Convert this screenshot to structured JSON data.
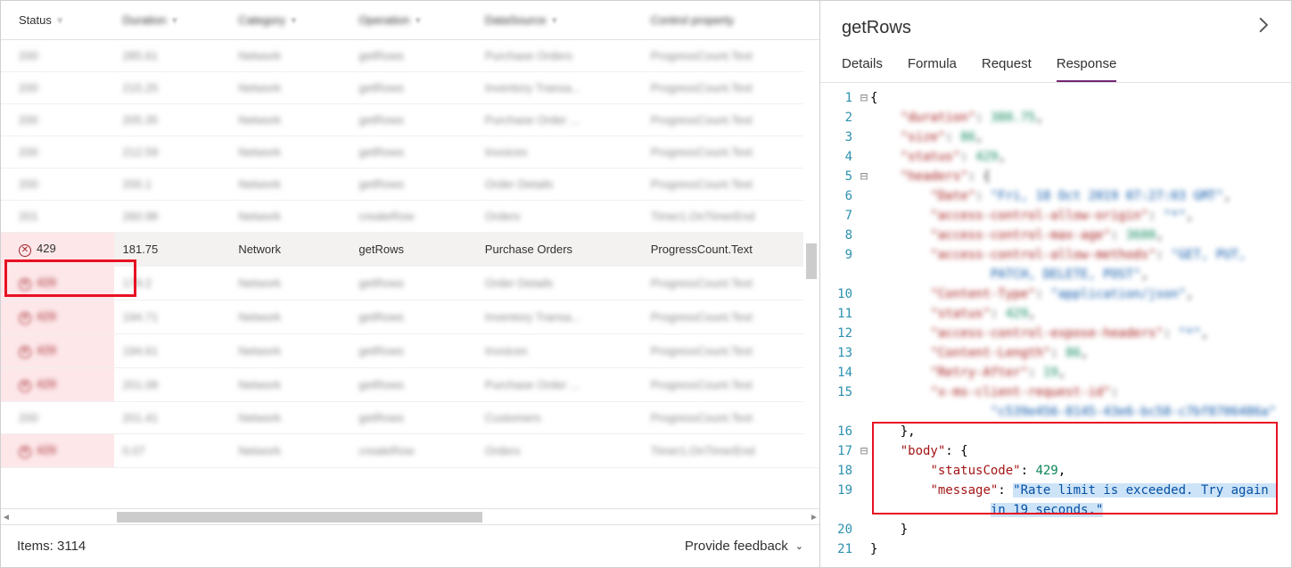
{
  "table": {
    "columns": [
      "Status",
      "Duration",
      "Category",
      "Operation",
      "DataSource",
      "Control property"
    ],
    "rows": [
      {
        "status": "200",
        "duration": "285.61",
        "category": "Network",
        "operation": "getRows",
        "datasource": "Purchase Orders",
        "control": "ProgressCount.Text",
        "err": false,
        "blur": true
      },
      {
        "status": "200",
        "duration": "215.25",
        "category": "Network",
        "operation": "getRows",
        "datasource": "Inventory Transa...",
        "control": "ProgressCount.Text",
        "err": false,
        "blur": true
      },
      {
        "status": "200",
        "duration": "205.35",
        "category": "Network",
        "operation": "getRows",
        "datasource": "Purchase Order ...",
        "control": "ProgressCount.Text",
        "err": false,
        "blur": true
      },
      {
        "status": "200",
        "duration": "212.59",
        "category": "Network",
        "operation": "getRows",
        "datasource": "Invoices",
        "control": "ProgressCount.Text",
        "err": false,
        "blur": true
      },
      {
        "status": "200",
        "duration": "200.1",
        "category": "Network",
        "operation": "getRows",
        "datasource": "Order Details",
        "control": "ProgressCount.Text",
        "err": false,
        "blur": true
      },
      {
        "status": "201",
        "duration": "260.98",
        "category": "Network",
        "operation": "createRow",
        "datasource": "Orders",
        "control": "Timer1.OnTimerEnd",
        "err": false,
        "blur": true
      },
      {
        "status": "429",
        "duration": "181.75",
        "category": "Network",
        "operation": "getRows",
        "datasource": "Purchase Orders",
        "control": "ProgressCount.Text",
        "err": true,
        "blur": false,
        "selected": true
      },
      {
        "status": "429",
        "duration": "178.2",
        "category": "Network",
        "operation": "getRows",
        "datasource": "Order Details",
        "control": "ProgressCount.Text",
        "err": true,
        "blur": true
      },
      {
        "status": "429",
        "duration": "194.71",
        "category": "Network",
        "operation": "getRows",
        "datasource": "Inventory Transa...",
        "control": "ProgressCount.Text",
        "err": true,
        "blur": true
      },
      {
        "status": "429",
        "duration": "194.61",
        "category": "Network",
        "operation": "getRows",
        "datasource": "Invoices",
        "control": "ProgressCount.Text",
        "err": true,
        "blur": true
      },
      {
        "status": "429",
        "duration": "201.08",
        "category": "Network",
        "operation": "getRows",
        "datasource": "Purchase Order ...",
        "control": "ProgressCount.Text",
        "err": true,
        "blur": true
      },
      {
        "status": "200",
        "duration": "201.41",
        "category": "Network",
        "operation": "getRows",
        "datasource": "Customers",
        "control": "ProgressCount.Text",
        "err": false,
        "blur": true
      },
      {
        "status": "429",
        "duration": "0.07",
        "category": "Network",
        "operation": "createRow",
        "datasource": "Orders",
        "control": "Timer1.OnTimerEnd",
        "err": true,
        "blur": true
      }
    ]
  },
  "footer": {
    "items_label": "Items: 3114",
    "feedback": "Provide feedback"
  },
  "right": {
    "title": "getRows",
    "tabs": [
      "Details",
      "Formula",
      "Request",
      "Response"
    ],
    "active_tab": 3,
    "code": [
      {
        "n": 1,
        "fold": "⊟",
        "ind": 0,
        "blur": false,
        "segs": [
          {
            "t": "{",
            "c": "k-punc"
          }
        ]
      },
      {
        "n": 2,
        "fold": "",
        "ind": 2,
        "blur": true,
        "segs": [
          {
            "t": "\"duration\"",
            "c": "k-str"
          },
          {
            "t": ": ",
            "c": "k-punc"
          },
          {
            "t": "380.75",
            "c": "k-val-num"
          },
          {
            "t": ",",
            "c": "k-punc"
          }
        ]
      },
      {
        "n": 3,
        "fold": "",
        "ind": 2,
        "blur": true,
        "segs": [
          {
            "t": "\"size\"",
            "c": "k-str"
          },
          {
            "t": ": ",
            "c": "k-punc"
          },
          {
            "t": "86",
            "c": "k-val-num"
          },
          {
            "t": ",",
            "c": "k-punc"
          }
        ]
      },
      {
        "n": 4,
        "fold": "",
        "ind": 2,
        "blur": true,
        "segs": [
          {
            "t": "\"status\"",
            "c": "k-str"
          },
          {
            "t": ": ",
            "c": "k-punc"
          },
          {
            "t": "429",
            "c": "k-val-num"
          },
          {
            "t": ",",
            "c": "k-punc"
          }
        ]
      },
      {
        "n": 5,
        "fold": "⊟",
        "ind": 2,
        "blur": true,
        "segs": [
          {
            "t": "\"headers\"",
            "c": "k-str"
          },
          {
            "t": ": {",
            "c": "k-punc"
          }
        ]
      },
      {
        "n": 6,
        "fold": "",
        "ind": 4,
        "blur": true,
        "segs": [
          {
            "t": "\"Date\"",
            "c": "k-str"
          },
          {
            "t": ": ",
            "c": "k-punc"
          },
          {
            "t": "\"Fri, 18 Oct 2019 07:27:03 GMT\"",
            "c": "k-val-str"
          },
          {
            "t": ",",
            "c": "k-punc"
          }
        ]
      },
      {
        "n": 7,
        "fold": "",
        "ind": 4,
        "blur": true,
        "segs": [
          {
            "t": "\"access-control-allow-origin\"",
            "c": "k-str"
          },
          {
            "t": ": ",
            "c": "k-punc"
          },
          {
            "t": "\"*\"",
            "c": "k-val-str"
          },
          {
            "t": ",",
            "c": "k-punc"
          }
        ]
      },
      {
        "n": 8,
        "fold": "",
        "ind": 4,
        "blur": true,
        "segs": [
          {
            "t": "\"access-control-max-age\"",
            "c": "k-str"
          },
          {
            "t": ": ",
            "c": "k-punc"
          },
          {
            "t": "3600",
            "c": "k-val-num"
          },
          {
            "t": ",",
            "c": "k-punc"
          }
        ]
      },
      {
        "n": 9,
        "fold": "",
        "ind": 4,
        "blur": true,
        "segs": [
          {
            "t": "\"access-control-allow-methods\"",
            "c": "k-str"
          },
          {
            "t": ": ",
            "c": "k-punc"
          },
          {
            "t": "\"GET, PUT,",
            "c": "k-val-str"
          }
        ]
      },
      {
        "n": "",
        "fold": "",
        "ind": 8,
        "blur": true,
        "segs": [
          {
            "t": "PATCH, DELETE, POST\"",
            "c": "k-val-str"
          },
          {
            "t": ",",
            "c": "k-punc"
          }
        ]
      },
      {
        "n": 10,
        "fold": "",
        "ind": 4,
        "blur": true,
        "segs": [
          {
            "t": "\"Content-Type\"",
            "c": "k-str"
          },
          {
            "t": ": ",
            "c": "k-punc"
          },
          {
            "t": "\"application/json\"",
            "c": "k-val-str"
          },
          {
            "t": ",",
            "c": "k-punc"
          }
        ]
      },
      {
        "n": 11,
        "fold": "",
        "ind": 4,
        "blur": true,
        "segs": [
          {
            "t": "\"status\"",
            "c": "k-str"
          },
          {
            "t": ": ",
            "c": "k-punc"
          },
          {
            "t": "429",
            "c": "k-val-num"
          },
          {
            "t": ",",
            "c": "k-punc"
          }
        ]
      },
      {
        "n": 12,
        "fold": "",
        "ind": 4,
        "blur": true,
        "segs": [
          {
            "t": "\"access-control-expose-headers\"",
            "c": "k-str"
          },
          {
            "t": ": ",
            "c": "k-punc"
          },
          {
            "t": "\"*\"",
            "c": "k-val-str"
          },
          {
            "t": ",",
            "c": "k-punc"
          }
        ]
      },
      {
        "n": 13,
        "fold": "",
        "ind": 4,
        "blur": true,
        "segs": [
          {
            "t": "\"Content-Length\"",
            "c": "k-str"
          },
          {
            "t": ": ",
            "c": "k-punc"
          },
          {
            "t": "86",
            "c": "k-val-num"
          },
          {
            "t": ",",
            "c": "k-punc"
          }
        ]
      },
      {
        "n": 14,
        "fold": "",
        "ind": 4,
        "blur": true,
        "segs": [
          {
            "t": "\"Retry-After\"",
            "c": "k-str"
          },
          {
            "t": ": ",
            "c": "k-punc"
          },
          {
            "t": "19",
            "c": "k-val-num"
          },
          {
            "t": ",",
            "c": "k-punc"
          }
        ]
      },
      {
        "n": 15,
        "fold": "",
        "ind": 4,
        "blur": true,
        "segs": [
          {
            "t": "\"x-ms-client-request-id\"",
            "c": "k-str"
          },
          {
            "t": ":",
            "c": "k-punc"
          }
        ]
      },
      {
        "n": "",
        "fold": "",
        "ind": 8,
        "blur": true,
        "segs": [
          {
            "t": "\"c539e456-8145-43e6-bc58-c7bf8706486a\"",
            "c": "k-val-str"
          }
        ]
      },
      {
        "n": 16,
        "fold": "",
        "ind": 2,
        "blur": false,
        "segs": [
          {
            "t": "},",
            "c": "k-punc"
          }
        ]
      },
      {
        "n": 17,
        "fold": "⊟",
        "ind": 2,
        "blur": false,
        "segs": [
          {
            "t": "\"body\"",
            "c": "k-str"
          },
          {
            "t": ": {",
            "c": "k-punc"
          }
        ]
      },
      {
        "n": 18,
        "fold": "",
        "ind": 4,
        "blur": false,
        "segs": [
          {
            "t": "\"statusCode\"",
            "c": "k-str"
          },
          {
            "t": ": ",
            "c": "k-punc"
          },
          {
            "t": "429",
            "c": "k-val-num"
          },
          {
            "t": ",",
            "c": "k-punc"
          }
        ]
      },
      {
        "n": 19,
        "fold": "",
        "ind": 4,
        "blur": false,
        "segs": [
          {
            "t": "\"message\"",
            "c": "k-str"
          },
          {
            "t": ": ",
            "c": "k-punc"
          },
          {
            "t": "\"Rate limit is exceeded. Try again ",
            "c": "k-val-str",
            "hl": true
          }
        ]
      },
      {
        "n": "",
        "fold": "",
        "ind": 8,
        "blur": false,
        "segs": [
          {
            "t": "in 19 seconds.\"",
            "c": "k-val-str",
            "hl": true
          }
        ]
      },
      {
        "n": 20,
        "fold": "",
        "ind": 2,
        "blur": false,
        "segs": [
          {
            "t": "}",
            "c": "k-punc"
          }
        ]
      },
      {
        "n": 21,
        "fold": "",
        "ind": 0,
        "blur": false,
        "segs": [
          {
            "t": "}",
            "c": "k-punc"
          }
        ]
      }
    ]
  }
}
